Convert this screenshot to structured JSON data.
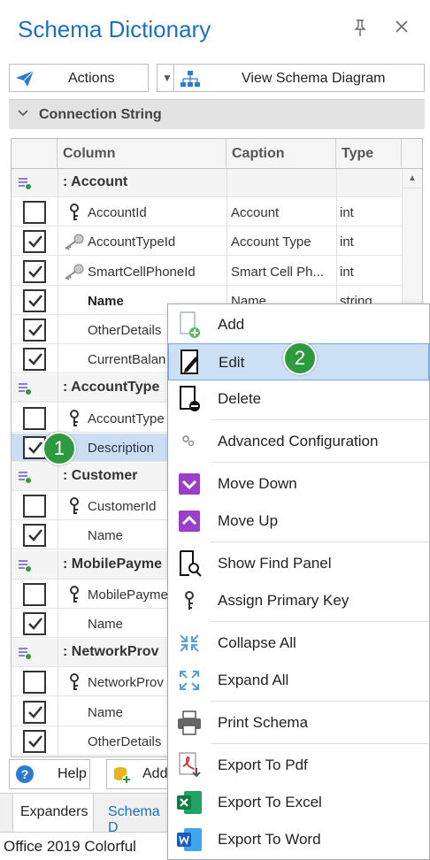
{
  "panel": {
    "title": "Schema Dictionary",
    "pin_icon": "pin-icon",
    "close_icon": "close-icon",
    "accent_color": "#1f6fbf"
  },
  "toolbar": {
    "actions_label": "Actions",
    "view_diagram_label": "View Schema Diagram"
  },
  "group": {
    "label": "Connection String"
  },
  "grid": {
    "columns": [
      "Column",
      "Caption",
      "Type"
    ],
    "rows": [
      {
        "kind": "group",
        "label": ": Account"
      },
      {
        "kind": "field",
        "checked": false,
        "key": "primary",
        "column": "AccountId",
        "caption": "Account",
        "type": "int",
        "bold": false
      },
      {
        "kind": "field",
        "checked": true,
        "key": "foreign",
        "column": "AccountTypeId",
        "caption": "Account Type",
        "type": "int",
        "bold": false
      },
      {
        "kind": "field",
        "checked": true,
        "key": "foreign",
        "column": "SmartCellPhoneId",
        "caption": "Smart Cell Ph...",
        "type": "int",
        "bold": false
      },
      {
        "kind": "field",
        "checked": true,
        "key": "none",
        "column": "Name",
        "caption": "Name",
        "type": "string",
        "bold": true
      },
      {
        "kind": "field",
        "checked": true,
        "key": "none",
        "column": "OtherDetails",
        "caption": "",
        "type": "",
        "bold": false
      },
      {
        "kind": "field",
        "checked": true,
        "key": "none",
        "column": "CurrentBalan",
        "caption": "",
        "type": "",
        "bold": false
      },
      {
        "kind": "group",
        "label": ": AccountType"
      },
      {
        "kind": "field",
        "checked": false,
        "key": "primary",
        "column": "AccountType",
        "caption": "",
        "type": "",
        "bold": false
      },
      {
        "kind": "field",
        "checked": true,
        "key": "none",
        "column": "Description",
        "caption": "",
        "type": "",
        "bold": false,
        "selected": true
      },
      {
        "kind": "group",
        "label": ": Customer"
      },
      {
        "kind": "field",
        "checked": false,
        "key": "primary",
        "column": "CustomerId",
        "caption": "",
        "type": "",
        "bold": false
      },
      {
        "kind": "field",
        "checked": true,
        "key": "none",
        "column": "Name",
        "caption": "",
        "type": "",
        "bold": false
      },
      {
        "kind": "group",
        "label": ": MobilePayme"
      },
      {
        "kind": "field",
        "checked": false,
        "key": "primary",
        "column": "MobilePayme",
        "caption": "",
        "type": "",
        "bold": false
      },
      {
        "kind": "field",
        "checked": true,
        "key": "none",
        "column": "Name",
        "caption": "",
        "type": "",
        "bold": false
      },
      {
        "kind": "group",
        "label": ": NetworkProv"
      },
      {
        "kind": "field",
        "checked": false,
        "key": "primary",
        "column": "NetworkProv",
        "caption": "",
        "type": "",
        "bold": false
      },
      {
        "kind": "field",
        "checked": true,
        "key": "none",
        "column": "Name",
        "caption": "",
        "type": "",
        "bold": false
      },
      {
        "kind": "field",
        "checked": true,
        "key": "none",
        "column": "OtherDetails",
        "caption": "",
        "type": "",
        "bold": false
      }
    ]
  },
  "bottombar": {
    "help_label": "Help",
    "add_label": "Add"
  },
  "tabs": {
    "expanders": "Expanders",
    "schema": "Schema D"
  },
  "status": {
    "theme": "Office 2019 Colorful"
  },
  "context_menu": {
    "items": [
      {
        "label": "Add",
        "icon": "add-document-icon"
      },
      {
        "label": "Edit",
        "icon": "edit-document-icon",
        "highlighted": true
      },
      {
        "label": "Delete",
        "icon": "delete-document-icon"
      },
      {
        "label": "Advanced Configuration",
        "icon": "gears-icon"
      },
      {
        "label": "Move Down",
        "icon": "chevron-down-icon"
      },
      {
        "label": "Move Up",
        "icon": "chevron-up-icon"
      },
      {
        "label": "Show Find Panel",
        "icon": "find-panel-icon"
      },
      {
        "label": "Assign Primary Key",
        "icon": "key-icon"
      },
      {
        "label": "Collapse All",
        "icon": "collapse-icon"
      },
      {
        "label": "Expand All",
        "icon": "expand-icon"
      },
      {
        "label": "Print Schema",
        "icon": "printer-icon"
      },
      {
        "label": "Export To Pdf",
        "icon": "pdf-icon"
      },
      {
        "label": "Export To Excel",
        "icon": "excel-icon"
      },
      {
        "label": "Export To Word",
        "icon": "word-icon"
      }
    ]
  },
  "badges": {
    "one": "1",
    "two": "2",
    "color": "#2e9a3e"
  }
}
